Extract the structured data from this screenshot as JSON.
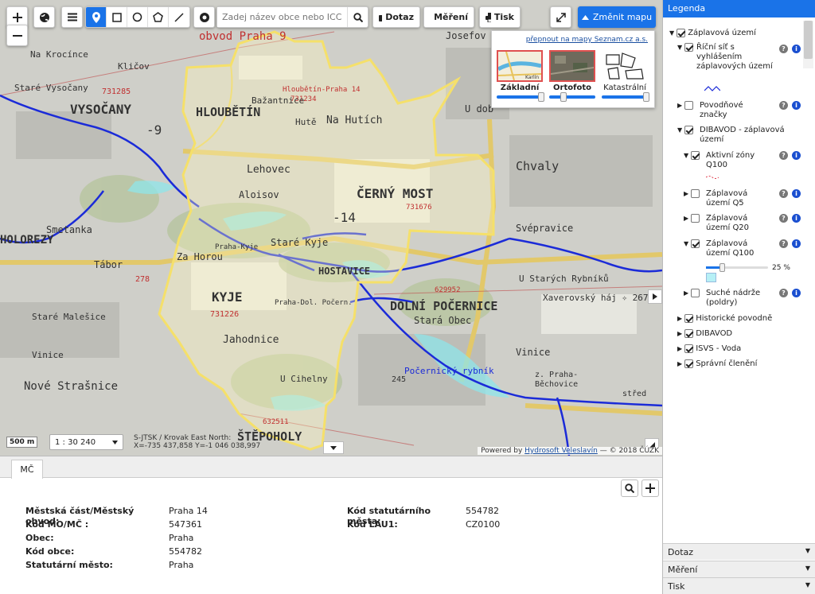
{
  "toolbar": {
    "search_placeholder": "Zadej název obce nebo ICC",
    "dotaz": "Dotaz",
    "mereni": "Měření",
    "tisk": "Tisk",
    "zmenit_mapu": "Změnit mapu"
  },
  "basemap": {
    "link": "přepnout na mapy Seznam.cz a.s.",
    "options": [
      {
        "label": "Základní",
        "thumb": "Karlín",
        "opacity": 1.0
      },
      {
        "label": "Ortofoto",
        "opacity": 0.3
      },
      {
        "label": "Katastrální",
        "opacity": 1.0
      }
    ]
  },
  "map": {
    "scale_bar": "500 m",
    "scale": "1 : 30 240",
    "crs": "S-JTSK / Krovak East North:",
    "coords": "X=-735 437,858 Y=-1 046 038,997",
    "credit_prefix": "Powered by",
    "credit_link": "Hydrosoft Veleslavín",
    "credit_suffix": "— © 2018 ČÚZK",
    "labels": {
      "obvod": "obvod Praha 9",
      "klicov": "Kličov",
      "krocinec": "Na Krocínce",
      "hloubetin_p14": "Hloubětín-Praha 14",
      "n731234": "731234",
      "hloubetin": "HLOUBĚTÍN",
      "vysocany": "VYSOČANY",
      "bazantnice": "Bažantnice",
      "hute": "Hutě",
      "nahutich": "Na Hutích",
      "lehovec": "Lehovec",
      "aloisov": "Aloisov",
      "cerny_most": "ČERNÝ MOST",
      "n14": "-14",
      "n9": "-9",
      "chvaly": "Chvaly",
      "svepravice": "Svépravice",
      "stare_kyje": "Staré Kyje",
      "za_horou": "Za Horou",
      "hostavice": "HOSTAVICE",
      "kyje": "KYJE",
      "n731226": "731226",
      "jahodnice": "Jahodnice",
      "dolni_pocernice": "DOLNÍ POČERNICE",
      "n629952": "629952",
      "stara_obec": "Stará Obec",
      "u_starych_rybniku": "U Starých Rybníků",
      "xaverovsky": "Xaverovský háj ✧ 267",
      "vinice": "Vinice",
      "vinice2": "Vinice",
      "pocernicky": "Počernický rybník",
      "u_cihelny": "U Cihelny",
      "n245": "245",
      "stepoholy": "ŠTĚPOHOLY",
      "prahovice": "z. Praha-",
      "bechovice": "Běchovice",
      "smetanka": "Smetanka",
      "holorezy": "HOLOREZY",
      "nove_strasnice": "Nové Strašnice",
      "tabor": "Tábor",
      "n278": "278",
      "stare_malesice": "Staré Malešice",
      "n731285": "731285",
      "stare_vysocany": "Staré Vysočany",
      "josefov": "Josefov",
      "u_dob": "U dob",
      "praha_kyje": "Praha-Kyje",
      "praha_dol": "Praha-Dol. Počern.",
      "stred": "střed",
      "n632511": "632511",
      "n731676": "731676"
    }
  },
  "bottom": {
    "tab": "MČ",
    "left_rows": [
      {
        "key": "Městská část/Městský obvod:",
        "value": "Praha 14"
      },
      {
        "key": "Kód MO/MČ :",
        "value": "547361"
      },
      {
        "key": "Obec:",
        "value": "Praha"
      },
      {
        "key": "Kód obce:",
        "value": "554782"
      },
      {
        "key": "Statutární město:",
        "value": "Praha"
      }
    ],
    "right_rows": [
      {
        "key": "Kód statutárního města:",
        "value": "554782"
      },
      {
        "key": "Kód LAU1:",
        "value": "CZ0100"
      }
    ]
  },
  "legend": {
    "title": "Legenda",
    "root": "Záplavová území",
    "ricni_sit": "Říční síť s vyhlášením záplavových území",
    "povodnove": "Povodňové značky",
    "dibavod_zapl": "DIBAVOD - záplavová území",
    "aktivni": "Aktivní zóny Q100",
    "q5": "Záplavová území Q5",
    "q20": "Záplavová území Q20",
    "q100": "Záplavová území Q100",
    "opacity": "25 %",
    "opacity_value": 0.25,
    "suche": "Suché nádrže (poldry)",
    "historicke": "Historické povodně",
    "dibavod": "DIBAVOD",
    "isvs": "ISVS - Voda",
    "spravni": "Správní členění",
    "accordion": [
      "Dotaz",
      "Měření",
      "Tisk"
    ]
  }
}
